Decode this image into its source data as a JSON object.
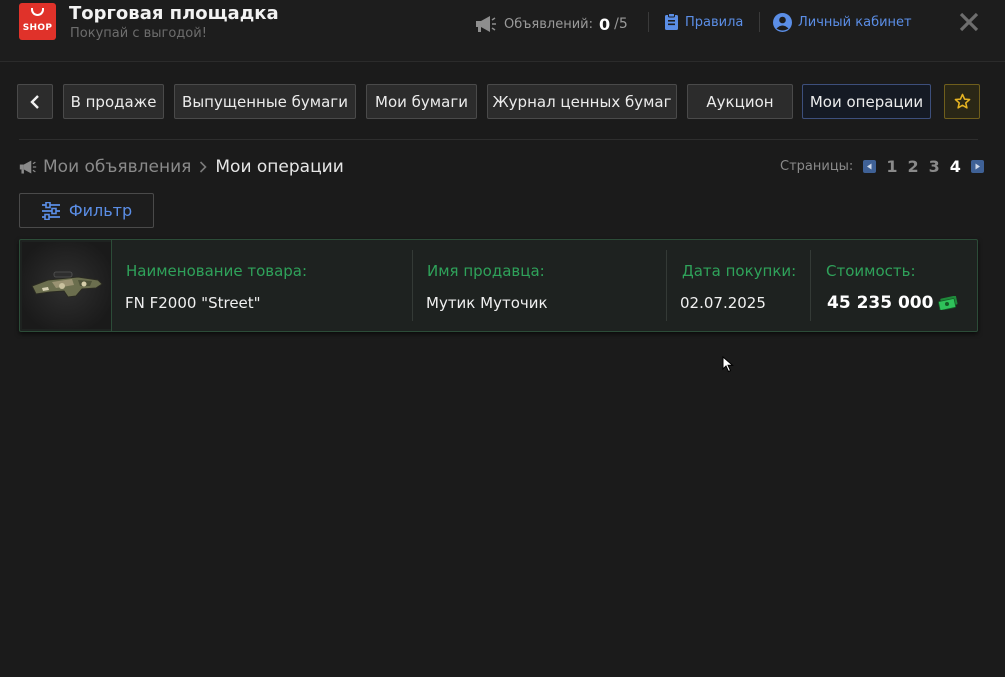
{
  "header": {
    "logo_text": "SHOP",
    "title": "Торговая площадка",
    "subtitle": "Покупай с выгодой!",
    "ads_label": "Объявлений:",
    "ads_count": "0",
    "ads_max": "/5",
    "rules_label": "Правила",
    "account_label": "Личный кабинет"
  },
  "nav": {
    "tabs": [
      {
        "label": "В продаже"
      },
      {
        "label": "Выпущенные бумаги"
      },
      {
        "label": "Мои бумаги"
      },
      {
        "label": "Журнал ценных бумаг"
      },
      {
        "label": "Аукцион"
      },
      {
        "label": "Мои операции",
        "active": true
      }
    ]
  },
  "breadcrumb": {
    "parent": "Мои объявления",
    "current": "Мои операции"
  },
  "pagination": {
    "label": "Страницы:",
    "pages": [
      "1",
      "2",
      "3",
      "4"
    ],
    "current": "4"
  },
  "filter": {
    "label": "Фильтр"
  },
  "operations": [
    {
      "item_label": "Наименование товара:",
      "item_value": "FN F2000 \"Street\"",
      "seller_label": "Имя продавца:",
      "seller_value": "Мутик Муточик",
      "date_label": "Дата покупки:",
      "date_value": "02.07.2025",
      "price_label": "Стоимость:",
      "price_value": "45 235 000",
      "currency_icon": "cash-icon"
    }
  ],
  "colors": {
    "accent_blue": "#5b8ee6",
    "label_green": "#2fa25a",
    "brand_red": "#e0322a",
    "star_gold": "#e6b422"
  }
}
